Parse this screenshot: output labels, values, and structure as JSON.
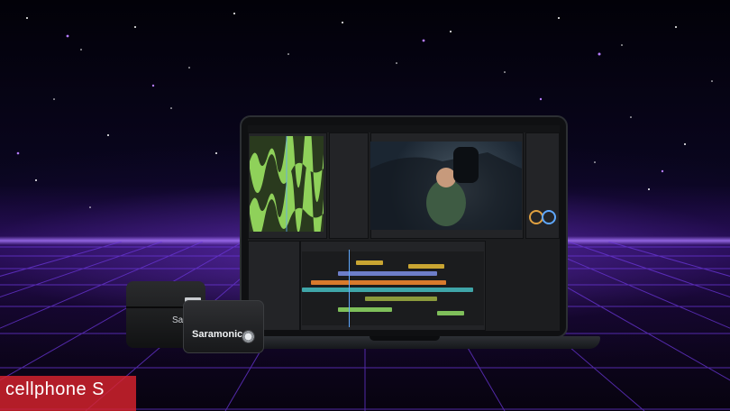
{
  "scene": {
    "background": "starry night sky over purple synthwave grid",
    "accent_color": "#8a4dff"
  },
  "device_case": {
    "brand_label": "Sar"
  },
  "receiver": {
    "brand_label": "Saramonic"
  },
  "watermark": {
    "text": "cellphone S",
    "color": "#d9232d"
  }
}
